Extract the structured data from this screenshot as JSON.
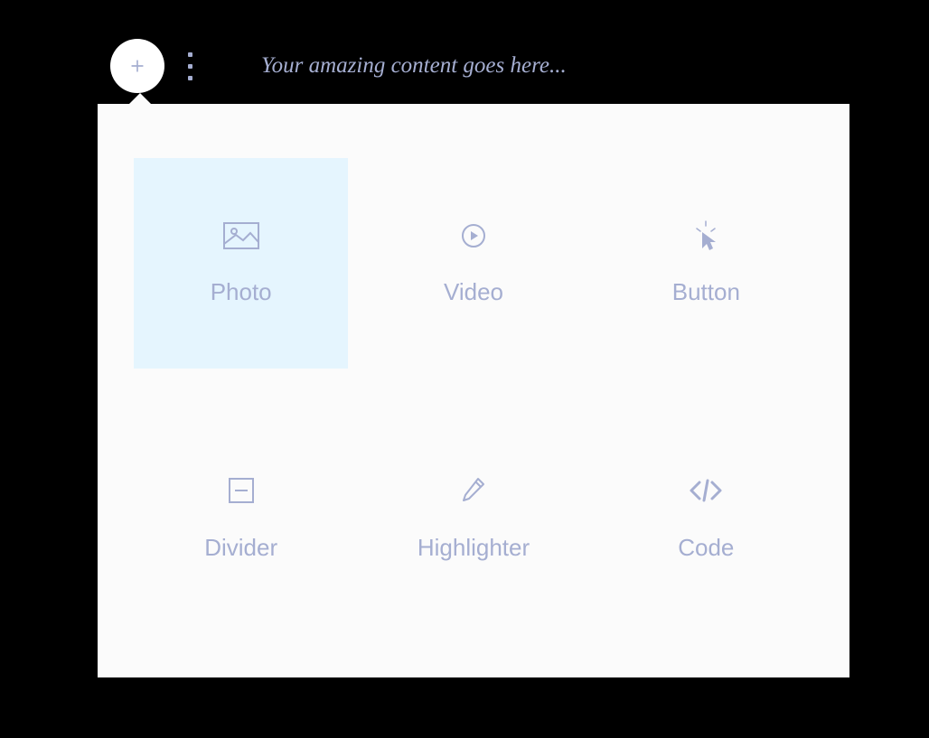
{
  "editor": {
    "placeholder": "Your amazing content goes here..."
  },
  "dropdown": {
    "options": [
      {
        "label": "Photo",
        "selected": true
      },
      {
        "label": "Video",
        "selected": false
      },
      {
        "label": "Button",
        "selected": false
      },
      {
        "label": "Divider",
        "selected": false
      },
      {
        "label": "Highlighter",
        "selected": false
      },
      {
        "label": "Code",
        "selected": false
      }
    ]
  }
}
